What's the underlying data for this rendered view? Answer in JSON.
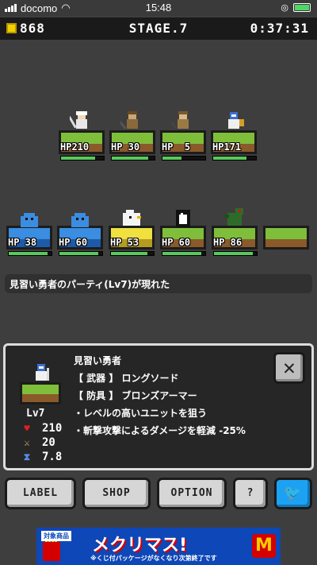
{
  "status_bar": {
    "carrier": "docomo",
    "time": "15:48"
  },
  "hud": {
    "coins": "868",
    "stage": "STAGE.7",
    "timer": "0:37:31"
  },
  "party_units": [
    {
      "name": "hero-white",
      "hp_text": "HP210",
      "hp_fraction": 0.8
    },
    {
      "name": "fighter",
      "hp_text": "HP 30",
      "hp_fraction": 0.85
    },
    {
      "name": "archer",
      "hp_text": "HP  5",
      "hp_fraction": 0.45
    },
    {
      "name": "knight",
      "hp_text": "HP171",
      "hp_fraction": 0.78
    }
  ],
  "enemy_units": [
    {
      "name": "blue-slime",
      "hp_text": "HP 38",
      "hp_fraction": 0.9,
      "tile": "ice"
    },
    {
      "name": "blue-slime",
      "hp_text": "HP 60",
      "hp_fraction": 0.9,
      "tile": "ice"
    },
    {
      "name": "white-bird",
      "hp_text": "HP 53",
      "hp_fraction": 0.85,
      "tile": "sand"
    },
    {
      "name": "black-penguin",
      "hp_text": "HP 60",
      "hp_fraction": 0.9,
      "tile": "grass"
    },
    {
      "name": "green-dragon",
      "hp_text": "HP 86",
      "hp_fraction": 0.9,
      "tile": "grass"
    }
  ],
  "message": "見習い勇者のパーティ(Lv7)が現れた",
  "info_panel": {
    "unit_name": "見習い勇者",
    "level": "Lv7",
    "weapon_line": "【 武器 】 ロングソード",
    "armor_line": "【 防具 】 ブロンズアーマー",
    "trait1": "・レベルの高いユニットを狙う",
    "trait2": "・斬撃攻撃によるダメージを軽減 -25%",
    "stats": {
      "hp": "210",
      "attack": "20",
      "speed": "7.8"
    }
  },
  "buttons": {
    "label": "LABEL",
    "shop": "SHOP",
    "option": "OPTION",
    "help": "?"
  },
  "ad": {
    "tag": "対象商品",
    "title": "メクリマス!",
    "subtitle": "※くじ付パッケージがなくなり次第終了です",
    "logo": "M"
  }
}
